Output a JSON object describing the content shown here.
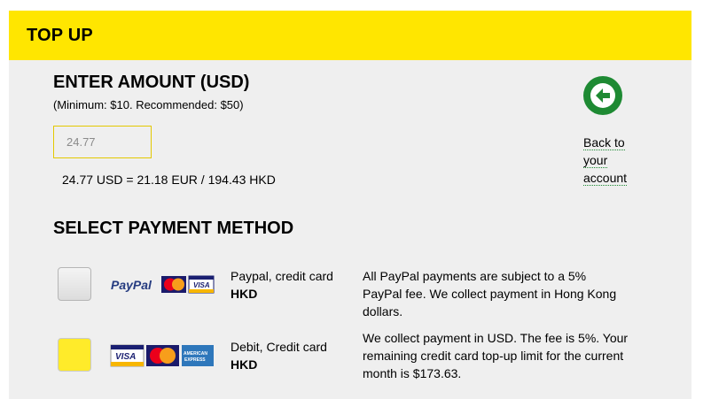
{
  "header": {
    "title": "TOP UP"
  },
  "amount": {
    "heading": "ENTER AMOUNT (USD)",
    "hint": "(Minimum: $10. Recommended: $50)",
    "value": "24.77",
    "conversion": "24.77 USD = 21.18 EUR / 194.43 HKD"
  },
  "back": {
    "label": "Back to your account",
    "icon": "arrow-left-icon",
    "color": "#1e8a33"
  },
  "payment": {
    "heading": "SELECT PAYMENT METHOD",
    "methods": [
      {
        "name": "Paypal, credit card",
        "currency": "HKD",
        "description": "All PayPal payments are subject to a 5% PayPal fee. We collect payment in Hong Kong dollars.",
        "logos": [
          "PayPal",
          "MasterCard",
          "VISA"
        ],
        "selected": false
      },
      {
        "name": "Debit, Credit card",
        "currency": "HKD",
        "description": "We collect payment in USD. The fee is 5%. Your remaining credit card top-up limit for the current month is $173.63.",
        "logos": [
          "VISA",
          "MasterCard",
          "AMERICAN EXPRESS"
        ],
        "selected": true
      }
    ]
  },
  "colors": {
    "accent": "#ffe600",
    "panel": "#efefef"
  }
}
